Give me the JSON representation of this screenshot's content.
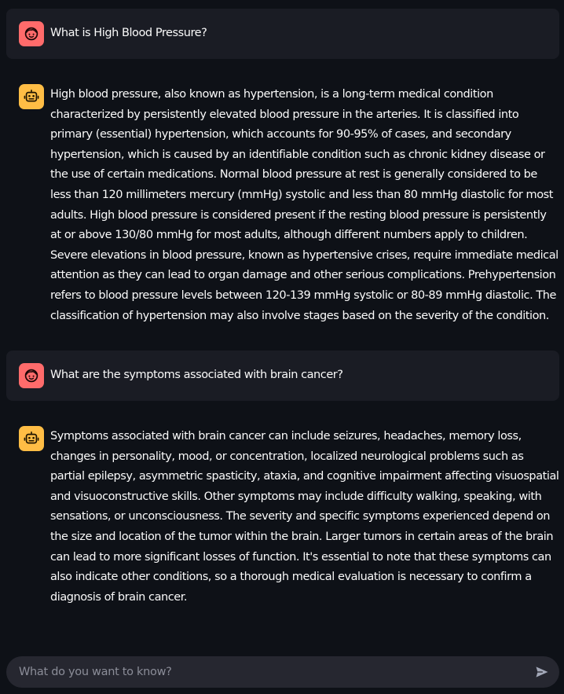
{
  "colors": {
    "background": "#0e1117",
    "user_message_bg": "#1a1c24",
    "user_avatar": "#ff6b6b",
    "assistant_avatar": "#ffbd45",
    "input_bg": "#262730",
    "text": "#fafafa",
    "placeholder": "#8b8d98"
  },
  "messages": [
    {
      "role": "user",
      "avatar_icon": "user-face-icon",
      "text": "What is High Blood Pressure?"
    },
    {
      "role": "assistant",
      "avatar_icon": "robot-icon",
      "text": "High blood pressure, also known as hypertension, is a long-term medical condition characterized by persistently elevated blood pressure in the arteries. It is classified into primary (essential) hypertension, which accounts for 90-95% of cases, and secondary hypertension, which is caused by an identifiable condition such as chronic kidney disease or the use of certain medications. Normal blood pressure at rest is generally considered to be less than 120 millimeters mercury (mmHg) systolic and less than 80 mmHg diastolic for most adults. High blood pressure is considered present if the resting blood pressure is persistently at or above 130/80 mmHg for most adults, although different numbers apply to children. Severe elevations in blood pressure, known as hypertensive crises, require immediate medical attention as they can lead to organ damage and other serious complications. Prehypertension refers to blood pressure levels between 120-139 mmHg systolic or 80-89 mmHg diastolic. The classification of hypertension may also involve stages based on the severity of the condition."
    },
    {
      "role": "user",
      "avatar_icon": "user-face-icon",
      "text": "What are the symptoms associated with brain cancer?"
    },
    {
      "role": "assistant",
      "avatar_icon": "robot-icon",
      "text": "Symptoms associated with brain cancer can include seizures, headaches, memory loss, changes in personality, mood, or concentration, localized neurological problems such as partial epilepsy, asymmetric spasticity, ataxia, and cognitive impairment affecting visuospatial and visuoconstructive skills. Other symptoms may include difficulty walking, speaking, with sensations, or unconsciousness. The severity and specific symptoms experienced depend on the size and location of the tumor within the brain. Larger tumors in certain areas of the brain can lead to more significant losses of function. It's essential to note that these symptoms can also indicate other conditions, so a thorough medical evaluation is necessary to confirm a diagnosis of brain cancer."
    }
  ],
  "chat_input": {
    "placeholder": "What do you want to know?",
    "value": "",
    "send_icon": "send-arrow-icon"
  }
}
